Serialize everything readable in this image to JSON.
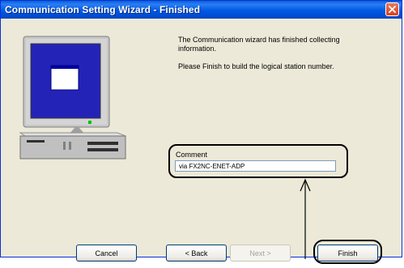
{
  "window": {
    "title": "Communication Setting Wizard - Finished"
  },
  "message": {
    "line1": "The Communication wizard has finished collecting information.",
    "line2": "Please Finish to build the logical station number."
  },
  "comment": {
    "label": "Comment",
    "value": "via FX2NC-ENET-ADP"
  },
  "buttons": {
    "cancel": "Cancel",
    "back": "< Back",
    "next": "Next >",
    "finish": "Finish"
  },
  "icons": {
    "close": "close-icon",
    "computer": "computer-illustration",
    "arrow": "arrow-up-icon"
  },
  "colors": {
    "titlebar": "#0058e6",
    "dialog_bg": "#ece9d8",
    "close_button": "#d6401c",
    "monitor_screen": "#1a1aa8",
    "callout": "#000000"
  }
}
